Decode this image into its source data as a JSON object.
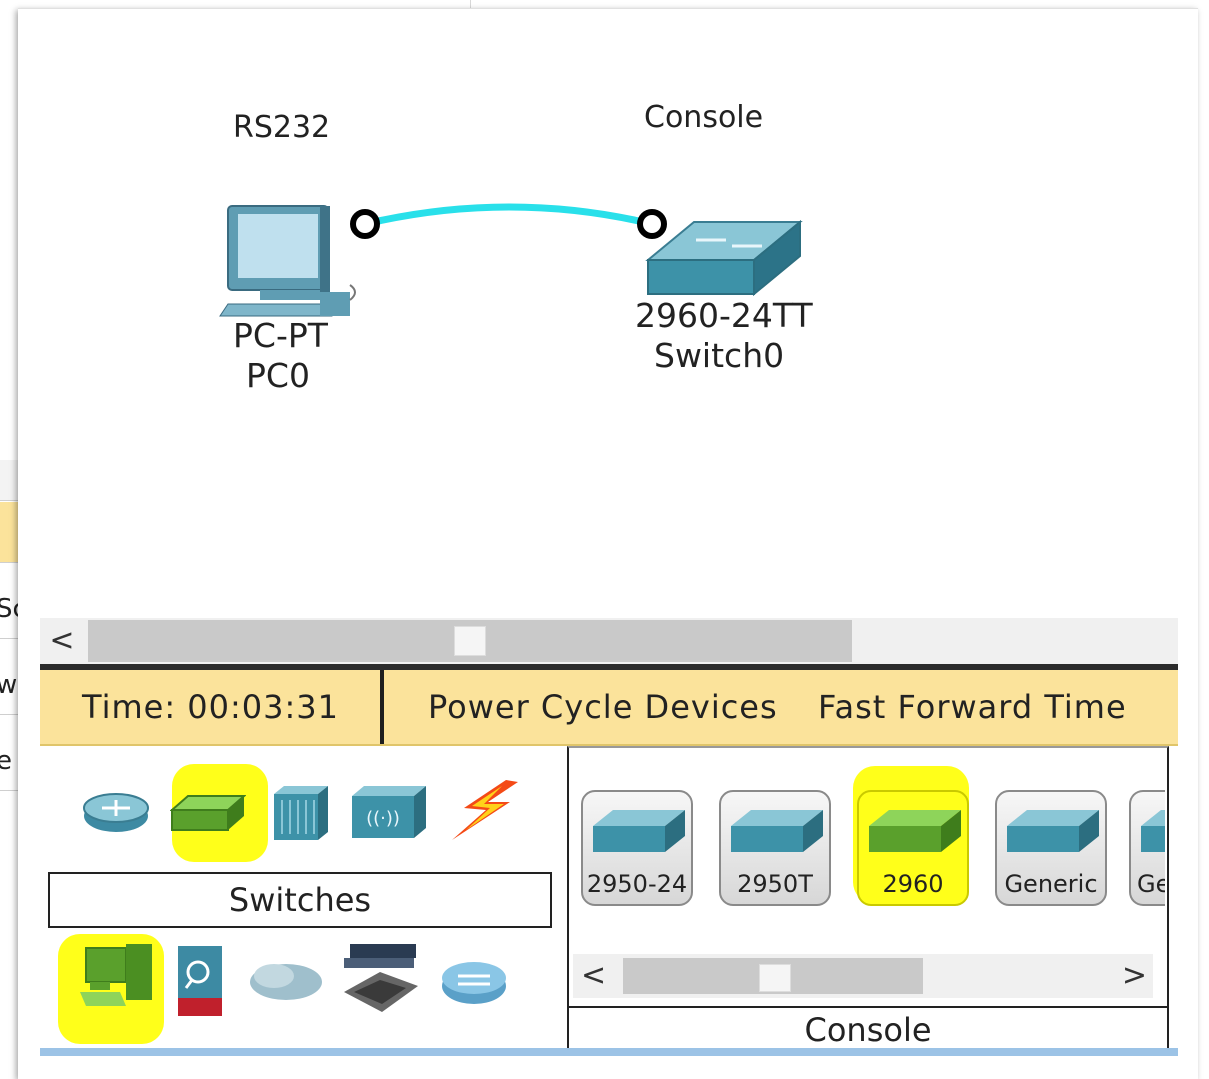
{
  "topology": {
    "pc": {
      "port_label": "RS232",
      "model": "PC-PT",
      "name": "PC0"
    },
    "switch": {
      "port_label": "Console",
      "model": "2960-24TT",
      "name": "Switch0"
    },
    "cable_color": "#29e0ea"
  },
  "background_window": {
    "fragments": [
      "Sc",
      "w",
      "e"
    ]
  },
  "horizontal_scrollbar": {
    "left_arrow": "<"
  },
  "toolbar": {
    "time_label": "Time: 00:03:31",
    "power_cycle": "Power Cycle Devices",
    "fast_forward": "Fast Forward Time"
  },
  "device_categories": {
    "selected_label": "Switches",
    "icons": [
      "router-icon",
      "switch-icon",
      "hub-icon",
      "wireless-icon",
      "connections-icon",
      "end-devices-icon",
      "security-icon",
      "wan-emulation-icon",
      "custom-device-icon",
      "multiuser-icon"
    ]
  },
  "device_models": {
    "items": [
      {
        "label": "2950-24",
        "selected": false
      },
      {
        "label": "2950T",
        "selected": false
      },
      {
        "label": "2960",
        "selected": true
      },
      {
        "label": "Generic",
        "selected": false
      },
      {
        "label": "Ge",
        "selected": false
      }
    ],
    "scroll_left": "<",
    "scroll_right": ">",
    "status_label": "Console"
  },
  "colors": {
    "toolbar_bg": "#fbe39b",
    "highlight": "#ffff1a",
    "switch_teal": "#3d92a8",
    "switch_green": "#5aa02c"
  }
}
